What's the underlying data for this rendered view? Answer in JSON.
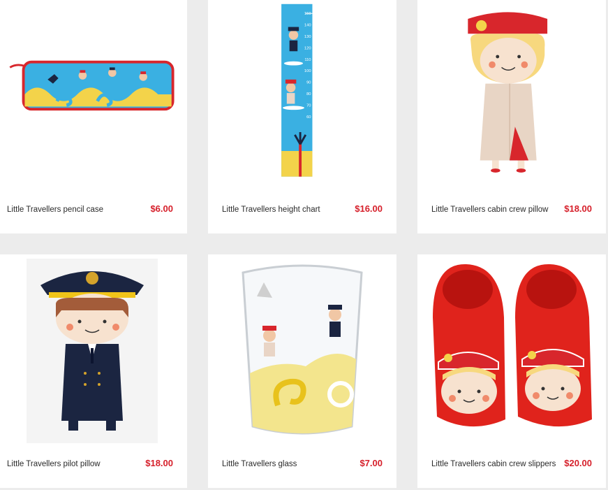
{
  "products": [
    {
      "name": "Little Travellers pencil case",
      "price": "$6.00",
      "image": "pencil-case"
    },
    {
      "name": "Little Travellers height chart",
      "price": "$16.00",
      "image": "height-chart"
    },
    {
      "name": "Little Travellers cabin crew pillow",
      "price": "$18.00",
      "image": "cabin-crew-pillow"
    },
    {
      "name": "Little Travellers pilot pillow",
      "price": "$18.00",
      "image": "pilot-pillow"
    },
    {
      "name": "Little Travellers glass",
      "price": "$7.00",
      "image": "glass"
    },
    {
      "name": "Little Travellers cabin crew slippers",
      "price": "$20.00",
      "image": "cabin-crew-slippers"
    }
  ],
  "height_chart_marks": [
    "150",
    "140",
    "130",
    "120",
    "110",
    "100",
    "90",
    "80",
    "70",
    "60"
  ],
  "colors": {
    "price": "#d6202b",
    "background": "#ececec",
    "card": "#ffffff",
    "emirates_red": "#d8262c",
    "sky_blue": "#3ab0e2",
    "sand_yellow": "#f3d34a",
    "navy": "#1b2541"
  }
}
